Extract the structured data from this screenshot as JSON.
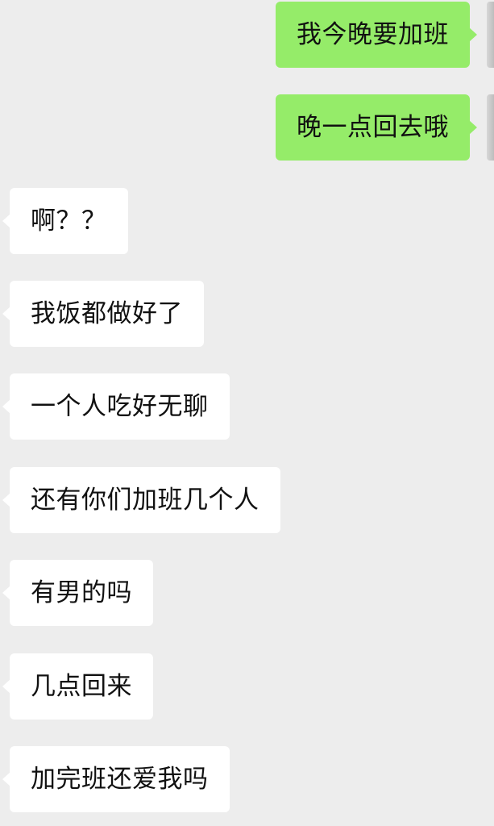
{
  "messages": [
    {
      "side": "out",
      "text": "我今晚要加班"
    },
    {
      "side": "out",
      "text": "晚一点回去哦"
    },
    {
      "side": "in",
      "text": "啊？？"
    },
    {
      "side": "in",
      "text": "我饭都做好了"
    },
    {
      "side": "in",
      "text": "一个人吃好无聊"
    },
    {
      "side": "in",
      "text": "还有你们加班几个人"
    },
    {
      "side": "in",
      "text": "有男的吗"
    },
    {
      "side": "in",
      "text": "几点回来"
    },
    {
      "side": "in",
      "text": "加完班还爱我吗"
    }
  ],
  "colors": {
    "background": "#ededed",
    "outgoing_bubble": "#95ec69",
    "incoming_bubble": "#ffffff"
  }
}
